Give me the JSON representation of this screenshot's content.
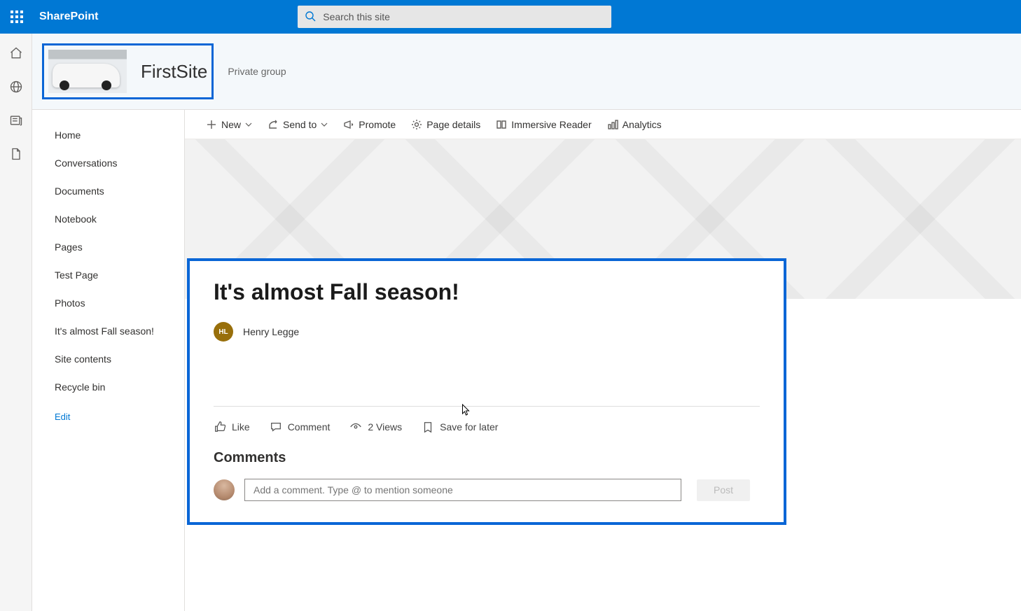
{
  "header": {
    "brand": "SharePoint",
    "search_placeholder": "Search this site"
  },
  "site": {
    "title": "FirstSite",
    "privacy": "Private group"
  },
  "left_nav": {
    "items": [
      {
        "label": "Home"
      },
      {
        "label": "Conversations"
      },
      {
        "label": "Documents"
      },
      {
        "label": "Notebook"
      },
      {
        "label": "Pages"
      },
      {
        "label": "Test Page"
      },
      {
        "label": "Photos"
      },
      {
        "label": "It's almost Fall season!"
      },
      {
        "label": "Site contents"
      },
      {
        "label": "Recycle bin"
      }
    ],
    "edit_label": "Edit"
  },
  "toolbar": {
    "new": "New",
    "send_to": "Send to",
    "promote": "Promote",
    "page_details": "Page details",
    "immersive": "Immersive Reader",
    "analytics": "Analytics"
  },
  "article": {
    "title": "It's almost Fall season!",
    "author_initials": "HL",
    "author_name": "Henry Legge",
    "reactions": {
      "like": "Like",
      "comment": "Comment",
      "views": "2 Views",
      "save": "Save for later"
    },
    "comments_heading": "Comments",
    "comment_placeholder": "Add a comment. Type @ to mention someone",
    "post_label": "Post"
  }
}
